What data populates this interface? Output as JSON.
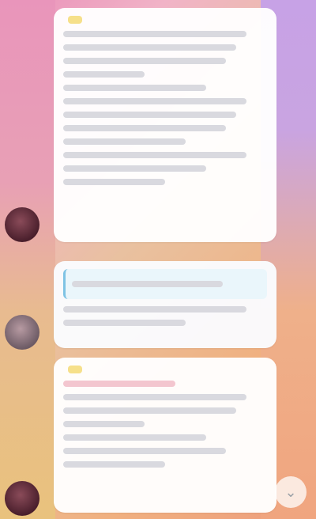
{
  "colors": {
    "sender_name": "#6fb2d6",
    "bubble_bg": "#ffffff",
    "reply_accent": "#7ec3e4"
  },
  "messages": [
    {
      "sender": "",
      "text": "",
      "time": ""
    },
    {
      "reply_to": "",
      "text": "",
      "time": ""
    },
    {
      "sender": "",
      "text": "",
      "time": ""
    }
  ],
  "icons": {
    "scroll_down": "chevron-down-icon"
  }
}
